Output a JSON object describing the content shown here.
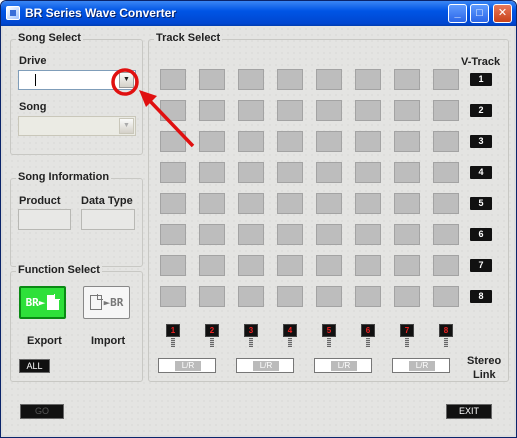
{
  "window": {
    "title": "BR Series Wave Converter",
    "controls": [
      "_",
      "□",
      "✕"
    ]
  },
  "song_select": {
    "group_label": "Song Select",
    "drive_label": "Drive",
    "drive_value": "",
    "song_label": "Song",
    "song_value": ""
  },
  "song_info": {
    "group_label": "Song Information",
    "product_label": "Product",
    "data_type_label": "Data Type",
    "product_value": "",
    "data_type_value": ""
  },
  "function_select": {
    "group_label": "Function Select",
    "export_icon_text": "BR►",
    "import_icon_text": "►BR",
    "export_label": "Export",
    "import_label": "Import",
    "all_label": "ALL"
  },
  "track_select": {
    "group_label": "Track Select",
    "vtrack_header": "V-Track",
    "vtracks": [
      "1",
      "2",
      "3",
      "4",
      "5",
      "6",
      "7",
      "8"
    ],
    "tracks": [
      "1",
      "2",
      "3",
      "4",
      "5",
      "6",
      "7",
      "8"
    ],
    "stereo_links": [
      "L/R",
      "L/R",
      "L/R",
      "L/R"
    ],
    "stereo_label_1": "Stereo",
    "stereo_label_2": "Link"
  },
  "footer": {
    "go_label": "GO",
    "exit_label": "EXIT"
  },
  "colors": {
    "export_active": "#2ee03a",
    "annotation": "#e01010",
    "titlebar": "#0055e5"
  }
}
